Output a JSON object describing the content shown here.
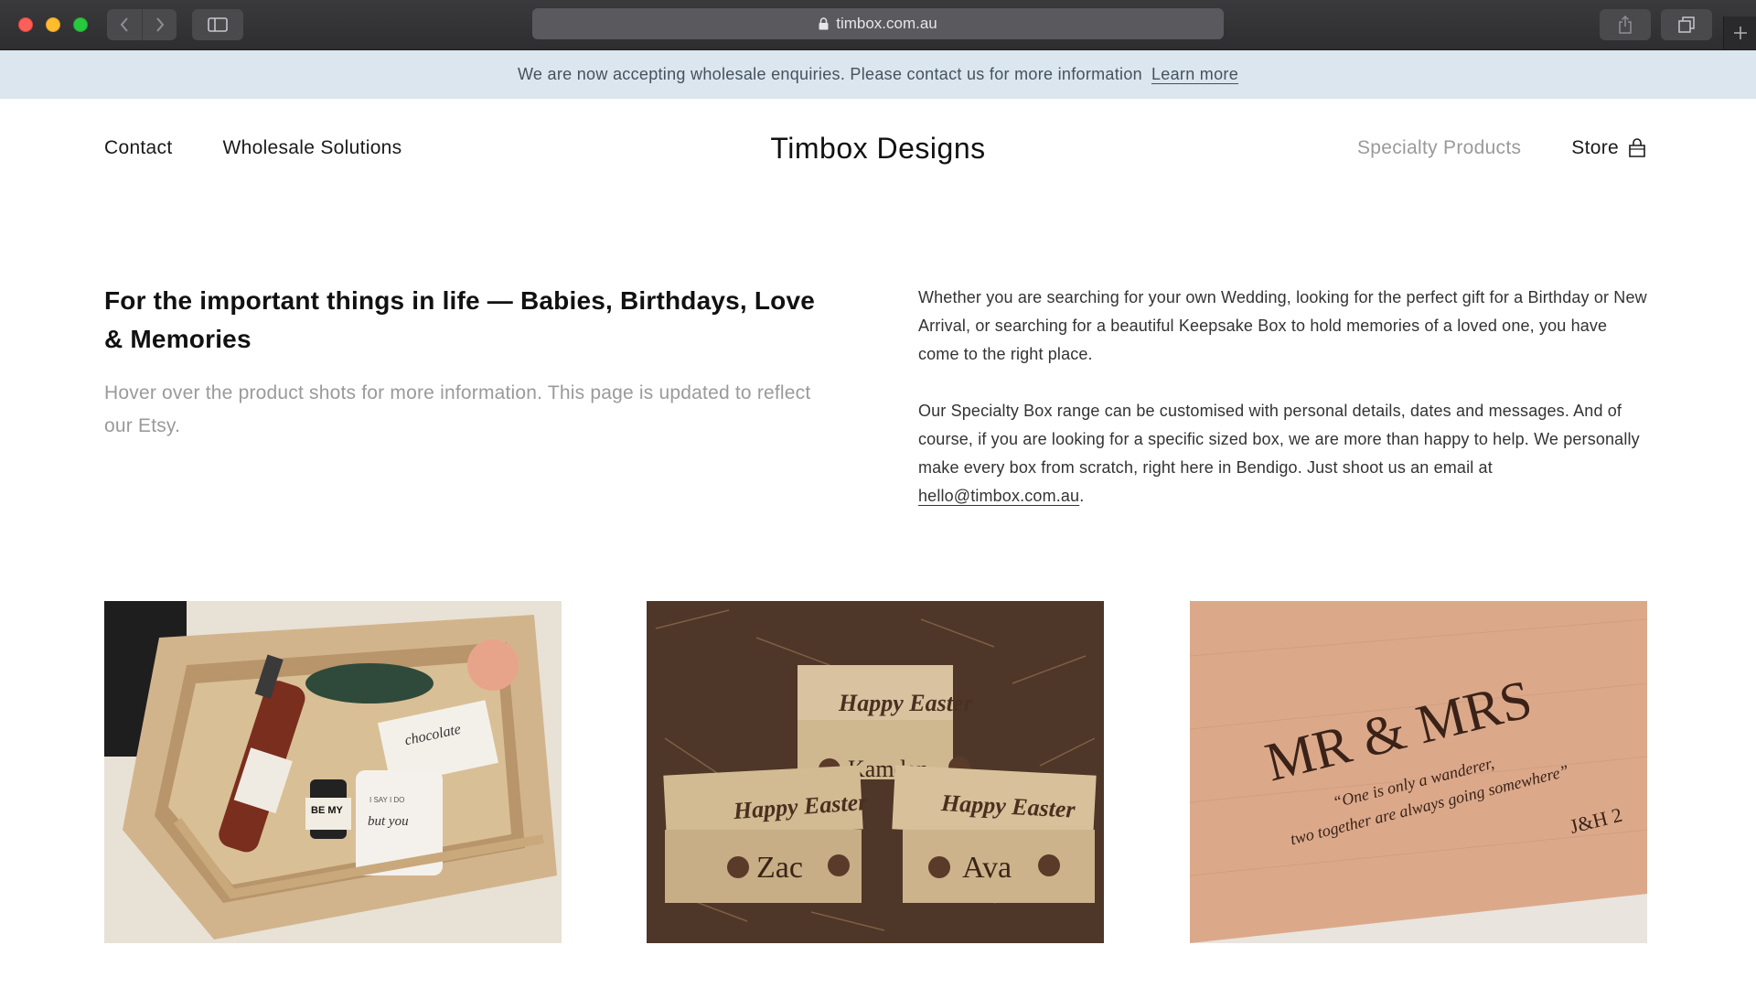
{
  "browser": {
    "url": "timbox.com.au"
  },
  "announcement": {
    "text": "We are now accepting wholesale enquiries. Please contact us for more information",
    "link_label": "Learn more"
  },
  "header": {
    "site_title": "Timbox Designs",
    "nav_left": [
      "Contact",
      "Wholesale Solutions"
    ],
    "nav_right": {
      "specialty": "Specialty Products",
      "store": "Store"
    }
  },
  "intro": {
    "heading": "For the important things in life — Babies, Birthdays, Love & Memories",
    "subheading": "Hover over the product shots for more information. This page is updated to reflect our Etsy.",
    "paragraph1": "Whether you are searching for your own Wedding, looking for the perfect gift for a Birthday or New Arrival, or searching for a beautiful Keepsake Box to hold memories of a loved one, you have come to the right place.",
    "paragraph2_text": "Our Specialty Box range can be customised with personal details, dates and messages. And of course, if you are looking for a specific sized box, we are more than happy to help. We personally make every box from scratch, right here in Bendigo. Just shoot us an email at",
    "email": "hello@timbox.com.au",
    "paragraph2_end": "."
  },
  "products": [
    {
      "labels": [
        "chocolate",
        "BE MY",
        "I SAY I DO",
        "but you"
      ]
    },
    {
      "labels": [
        "Happy Easter",
        "Kamden",
        "Happy Easter",
        "Zac",
        "Happy Easter",
        "Ava"
      ]
    },
    {
      "labels": [
        "MR & MRS",
        "“One is only a wanderer,",
        "two together are always going somewhere”",
        "J&H 2"
      ]
    }
  ],
  "icons": {
    "lock": "lock-icon",
    "back": "chevron-left-icon",
    "forward": "chevron-right-icon",
    "sidebar": "sidebar-icon",
    "share": "share-icon",
    "tabs": "tabs-icon",
    "new_tab": "plus-icon",
    "bag": "shopping-bag-icon"
  },
  "colors": {
    "announcement_bg": "#dbe6ef",
    "muted_text": "#9a9a9a"
  }
}
